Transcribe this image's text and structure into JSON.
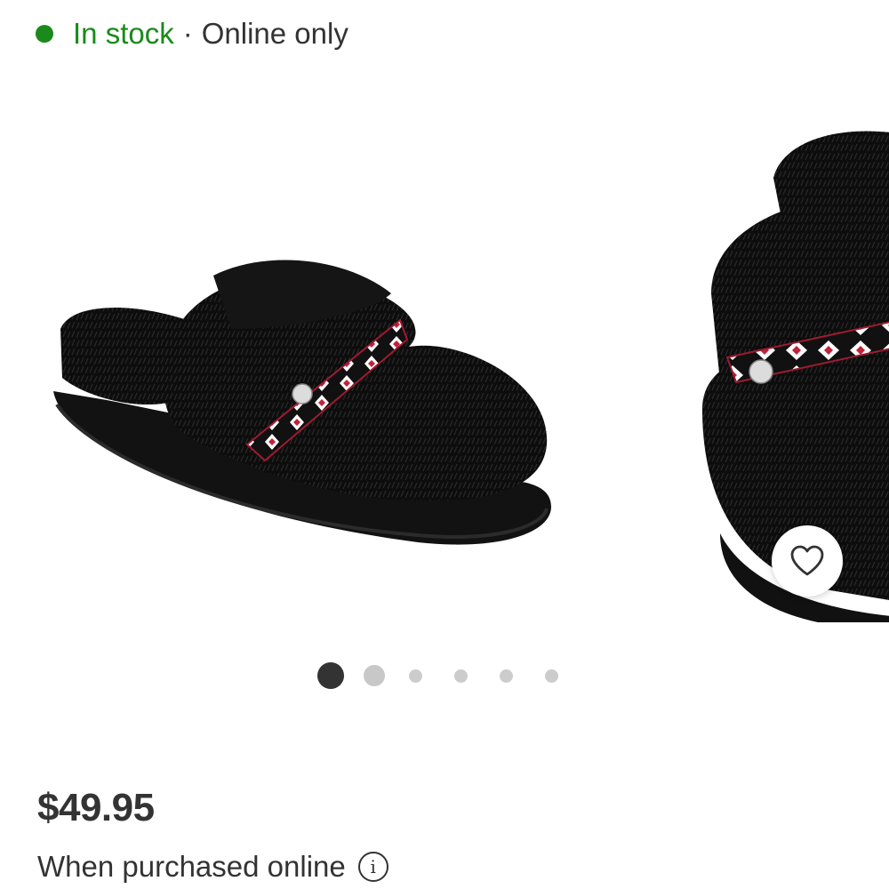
{
  "stock": {
    "status": "In stock",
    "separator": "·",
    "channel": "Online only",
    "status_color": "#1a8a1a"
  },
  "carousel": {
    "total_slides": 6,
    "active_index": 0,
    "favorite_icon": "heart-outline-icon"
  },
  "pricing": {
    "price": "$49.95",
    "purchase_note": "When purchased online",
    "info_icon_glyph": "i"
  }
}
